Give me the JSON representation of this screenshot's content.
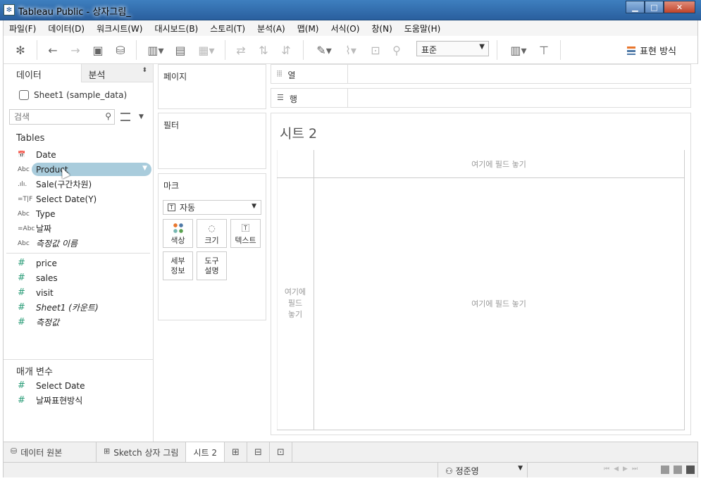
{
  "window": {
    "title": "Tableau Public - 상자그림_",
    "min_glyph": "▁",
    "max_glyph": "□",
    "close_glyph": "✕"
  },
  "menu": [
    "파일(F)",
    "데이터(D)",
    "워크시트(W)",
    "대시보드(B)",
    "스토리(T)",
    "분석(A)",
    "맵(M)",
    "서식(O)",
    "창(N)",
    "도움말(H)"
  ],
  "toolbar": {
    "fit_value": "표준",
    "show_me_label": "표현 방식"
  },
  "data_pane": {
    "tab_data": "데이터",
    "tab_analysis": "분석",
    "datasource": "Sheet1 (sample_data)",
    "search_placeholder": "검색",
    "tables_label": "Tables",
    "dimensions": [
      {
        "icon": "📅",
        "name": "Date"
      },
      {
        "icon": "Abc",
        "name": "Product"
      },
      {
        "icon": ".ılı.",
        "name": "Sale(구간차원)"
      },
      {
        "icon": "=T|F",
        "name": "Select Date(Y)"
      },
      {
        "icon": "Abc",
        "name": "Type"
      },
      {
        "icon": "=Abc",
        "name": "날짜"
      },
      {
        "icon": "Abc",
        "name": "측정값 이름"
      }
    ],
    "measures": [
      {
        "icon": "#",
        "name": "price"
      },
      {
        "icon": "#",
        "name": "sales"
      },
      {
        "icon": "#",
        "name": "visit"
      },
      {
        "icon": "#",
        "name": "Sheet1 (카운트)"
      },
      {
        "icon": "#",
        "name": "측정값"
      }
    ],
    "parameters_label": "매개 변수",
    "parameters": [
      {
        "icon": "#",
        "name": "Select Date"
      },
      {
        "icon": "#",
        "name": "날짜표현방식"
      }
    ]
  },
  "shelves": {
    "pages": "페이지",
    "filters": "필터",
    "marks": "마크",
    "marks_type": "자동",
    "mark_cards": {
      "color": "색상",
      "size": "크기",
      "text": "텍스트",
      "detail_1": "세부",
      "detail_2": "정보",
      "tooltip_1": "도구",
      "tooltip_2": "설명"
    },
    "columns": "열",
    "rows": "행"
  },
  "canvas": {
    "sheet_title": "시트 2",
    "drop_top": "여기에 필드 놓기",
    "drop_left_1": "여기에",
    "drop_left_2": "필드",
    "drop_left_3": "놓기",
    "drop_center": "여기에 필드 놓기"
  },
  "sheet_tabs": {
    "data_source": "데이터 원본",
    "sketch": "Sketch 상자 그림",
    "sheet2": "시트 2"
  },
  "status": {
    "user": "정준영"
  }
}
